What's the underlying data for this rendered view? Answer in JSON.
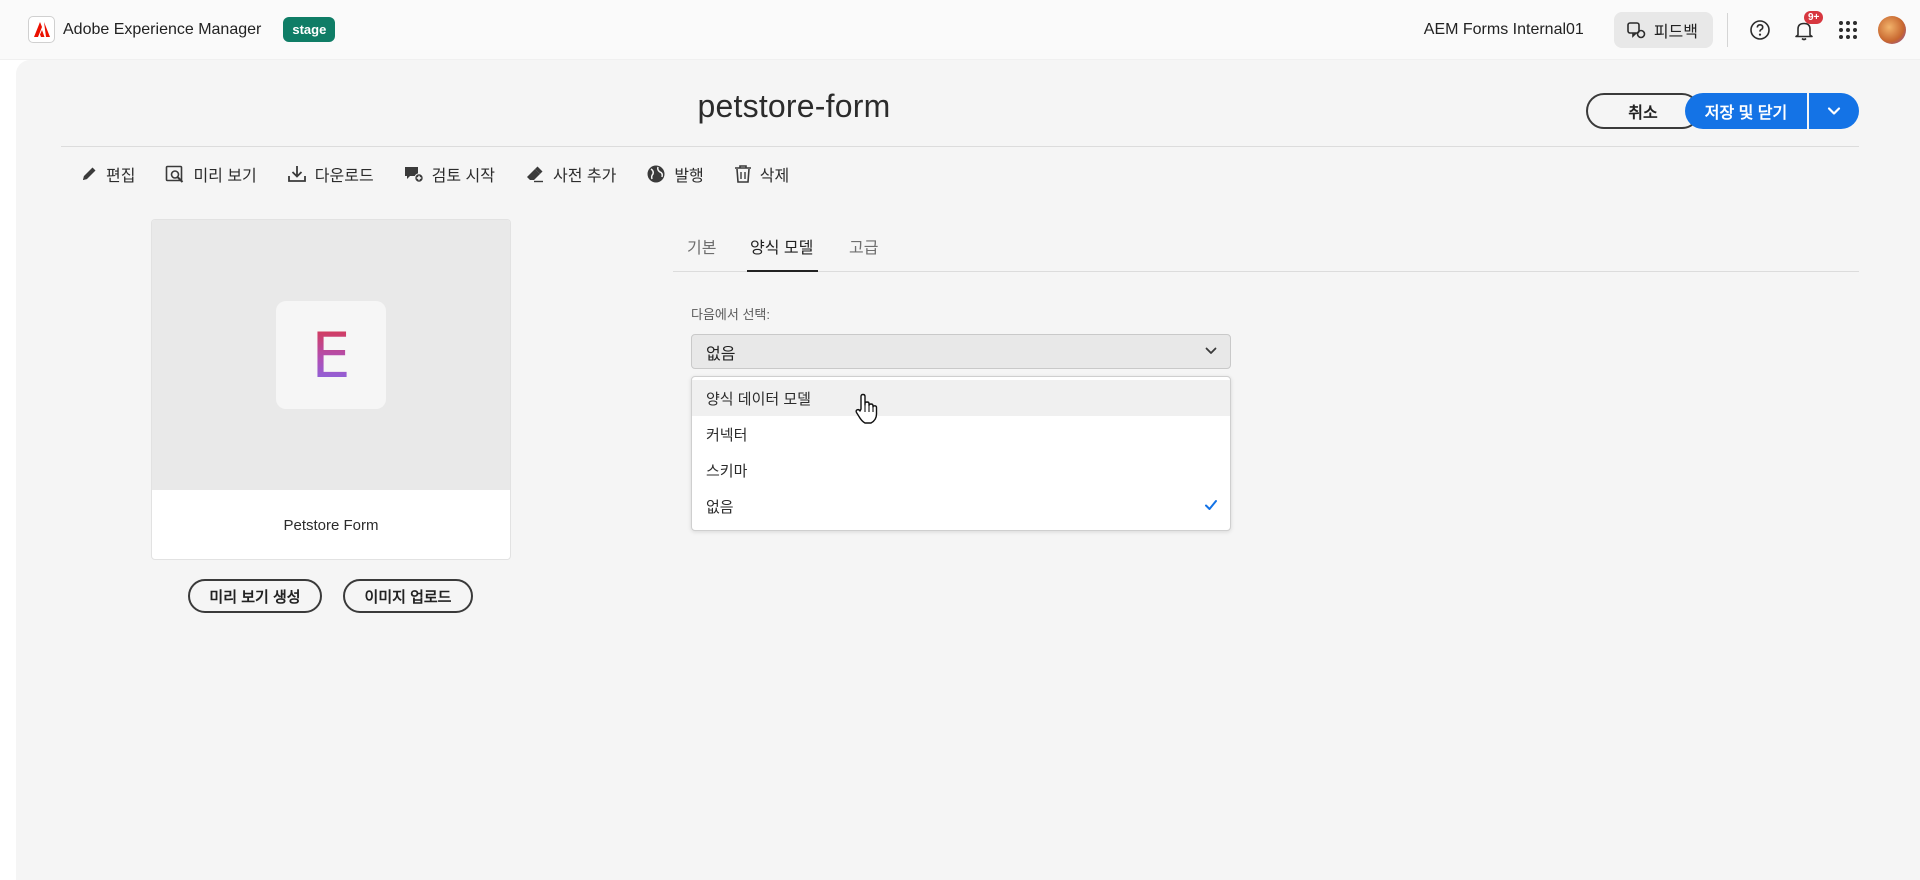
{
  "shell": {
    "app_name": "Adobe Experience Manager",
    "env_badge": "stage",
    "env_badge_color": "#0f7d66",
    "org_name": "AEM Forms Internal01",
    "feedback_label": "피드백",
    "notification_count": "9+"
  },
  "page": {
    "title": "petstore-form",
    "cancel_label": "취소",
    "save_label": "저장 및 닫기",
    "accent_color": "#1473e6"
  },
  "actions": [
    {
      "label": "편집",
      "icon": "pencil-icon"
    },
    {
      "label": "미리 보기",
      "icon": "preview-icon"
    },
    {
      "label": "다운로드",
      "icon": "download-icon"
    },
    {
      "label": "검토 시작",
      "icon": "review-icon"
    },
    {
      "label": "사전 추가",
      "icon": "eraser-icon"
    },
    {
      "label": "발행",
      "icon": "globe-icon"
    },
    {
      "label": "삭제",
      "icon": "trash-icon"
    }
  ],
  "card": {
    "letter": "E",
    "caption": "Petstore Form",
    "generate_preview_label": "미리 보기 생성",
    "upload_image_label": "이미지 업로드"
  },
  "tabs": [
    {
      "label": "기본",
      "active": false
    },
    {
      "label": "양식 모델",
      "active": true
    },
    {
      "label": "고급",
      "active": false
    }
  ],
  "form_model": {
    "field_label": "다음에서 선택:",
    "selected_value": "없음",
    "options": [
      {
        "label": "양식 데이터 모델",
        "hovered": true,
        "selected": false
      },
      {
        "label": "커넥터",
        "hovered": false,
        "selected": false
      },
      {
        "label": "스키마",
        "hovered": false,
        "selected": false
      },
      {
        "label": "없음",
        "hovered": false,
        "selected": true
      }
    ]
  }
}
